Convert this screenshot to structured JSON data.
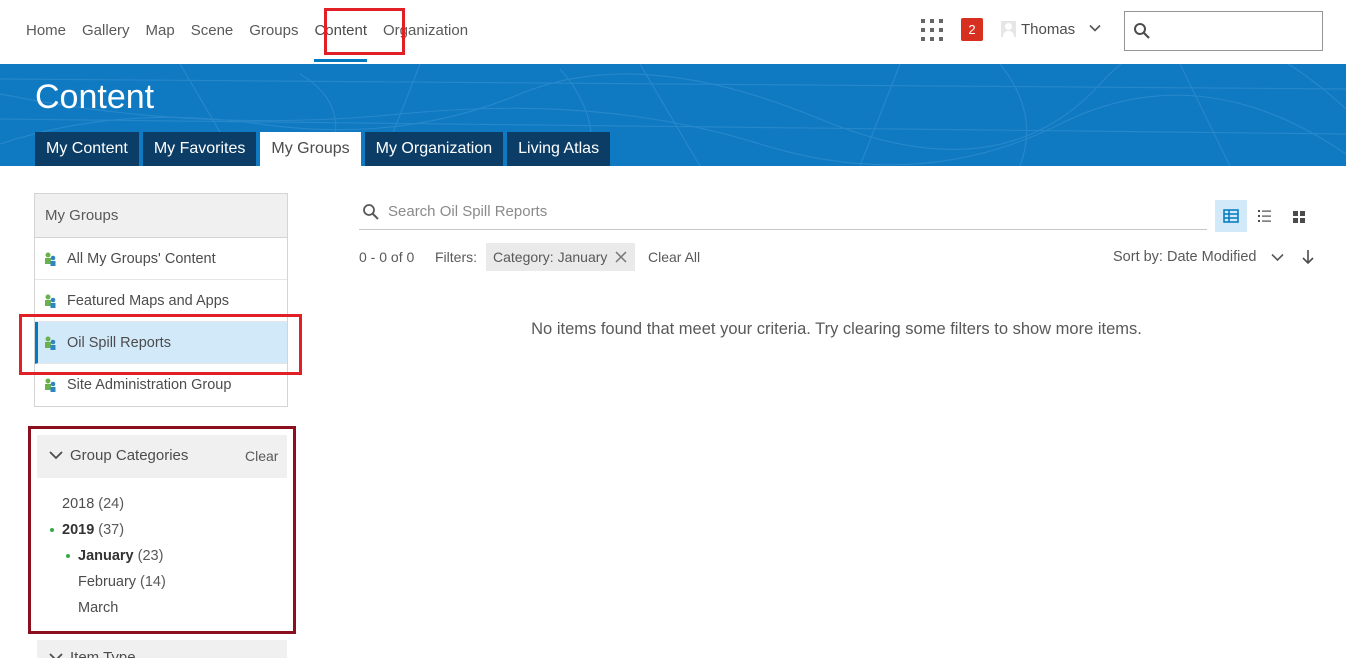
{
  "nav": {
    "links": [
      "Home",
      "Gallery",
      "Map",
      "Scene",
      "Groups",
      "Content",
      "Organization"
    ],
    "active": "Content",
    "notifications": "2",
    "user": "Thomas"
  },
  "banner": {
    "title": "Content",
    "tabs": [
      "My Content",
      "My Favorites",
      "My Groups",
      "My Organization",
      "Living Atlas"
    ],
    "active_tab": "My Groups"
  },
  "groups_panel": {
    "heading": "My Groups",
    "items": [
      "All My Groups' Content",
      "Featured Maps and Apps",
      "Oil Spill Reports",
      "Site Administration Group"
    ],
    "selected": "Oil Spill Reports"
  },
  "categories": {
    "title": "Group Categories",
    "clear": "Clear",
    "items": [
      {
        "label": "2018",
        "count": "(24)"
      },
      {
        "label": "2019",
        "count": "(37)"
      },
      {
        "label": "January",
        "count": "(23)"
      },
      {
        "label": "February",
        "count": "(14)"
      },
      {
        "label": "March",
        "count": ""
      }
    ],
    "next_section": "Item Type"
  },
  "main": {
    "search_placeholder": "Search Oil Spill Reports",
    "count": "0 - 0 of 0",
    "filters_label": "Filters:",
    "chip": "Category: January",
    "clear_all": "Clear All",
    "sort": "Sort by: Date Modified",
    "empty": "No items found that meet your criteria. Try clearing some filters to show more items."
  },
  "colors": {
    "accent": "#0079c1",
    "banner": "#0f79c2",
    "tab_dark": "#0b3d66",
    "highlight_red": "#e02026",
    "highlight_dark_red": "#8b0f1f",
    "badge": "#d83020"
  }
}
